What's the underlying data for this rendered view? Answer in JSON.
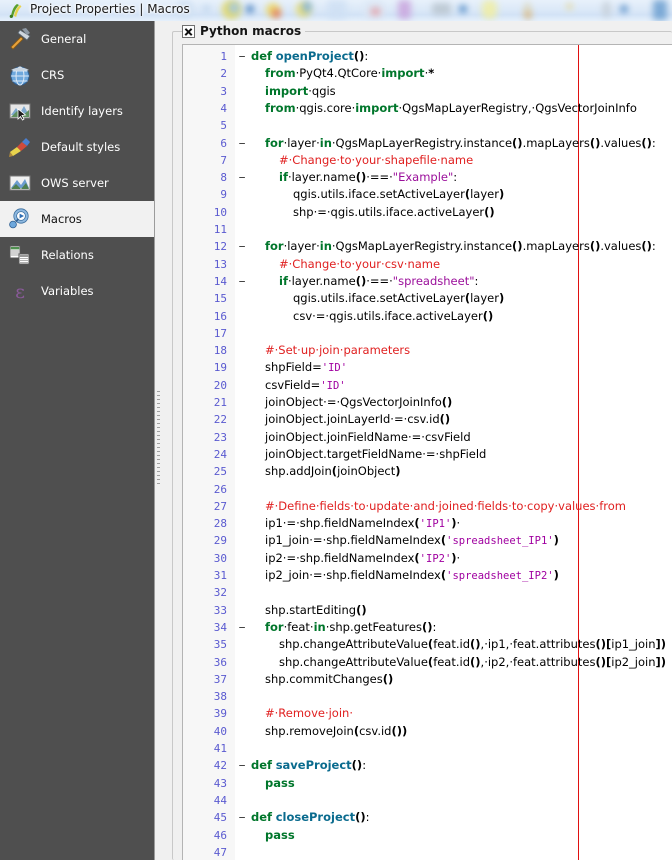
{
  "window": {
    "title": "Project Properties | Macros",
    "icon": "qgis-logo-icon"
  },
  "sidebar": {
    "items": [
      {
        "label": "General",
        "icon": "hammer-icon",
        "selected": false
      },
      {
        "label": "CRS",
        "icon": "globe-icon",
        "selected": false
      },
      {
        "label": "Identify layers",
        "icon": "identify-map-icon",
        "selected": false
      },
      {
        "label": "Default styles",
        "icon": "paintbrush-icon",
        "selected": false
      },
      {
        "label": "OWS server",
        "icon": "ows-map-icon",
        "selected": false
      },
      {
        "label": "Macros",
        "icon": "gear-play-icon",
        "selected": true
      },
      {
        "label": "Relations",
        "icon": "tables-icon",
        "selected": false
      },
      {
        "label": "Variables",
        "icon": "epsilon-icon",
        "selected": false
      }
    ]
  },
  "group": {
    "title": "Python macros",
    "checkbox_checked": true,
    "checkbox_glyph": "cross-check-icon"
  },
  "editor": {
    "first_line": 1,
    "last_line": 47,
    "margin_column_color": "#e01010",
    "lines": [
      {
        "n": 1,
        "fold": "−",
        "tokens": [
          {
            "t": "def",
            "c": "kw"
          },
          {
            "t": " ",
            "c": "sp"
          },
          {
            "t": "openProject",
            "c": "fn"
          },
          {
            "t": "()",
            "c": "pn"
          },
          {
            "t": ":",
            "c": "plain"
          }
        ]
      },
      {
        "n": 2,
        "fold": "",
        "indent": 1,
        "tokens": [
          {
            "t": "from",
            "c": "kw"
          },
          {
            "t": "·PyQt4.QtCore·",
            "c": "plain"
          },
          {
            "t": "import",
            "c": "kw"
          },
          {
            "t": "·",
            "c": "plain"
          },
          {
            "t": "*",
            "c": "pn"
          }
        ]
      },
      {
        "n": 3,
        "fold": "",
        "indent": 1,
        "tokens": [
          {
            "t": "import",
            "c": "kw"
          },
          {
            "t": "·qgis",
            "c": "plain"
          }
        ]
      },
      {
        "n": 4,
        "fold": "",
        "indent": 1,
        "tokens": [
          {
            "t": "from",
            "c": "kw"
          },
          {
            "t": "·qgis.core·",
            "c": "plain"
          },
          {
            "t": "import",
            "c": "kw"
          },
          {
            "t": "·QgsMapLayerRegistry,·QgsVectorJoinInfo",
            "c": "plain"
          }
        ]
      },
      {
        "n": 5,
        "fold": "",
        "indent": 1,
        "tokens": []
      },
      {
        "n": 6,
        "fold": "−",
        "indent": 1,
        "tokens": [
          {
            "t": "for",
            "c": "kw"
          },
          {
            "t": "·layer·",
            "c": "plain"
          },
          {
            "t": "in",
            "c": "kw"
          },
          {
            "t": "·QgsMapLayerRegistry.instance",
            "c": "plain"
          },
          {
            "t": "()",
            "c": "pn"
          },
          {
            "t": ".mapLayers",
            "c": "plain"
          },
          {
            "t": "()",
            "c": "pn"
          },
          {
            "t": ".values",
            "c": "plain"
          },
          {
            "t": "()",
            "c": "pn"
          },
          {
            "t": ":",
            "c": "plain"
          }
        ]
      },
      {
        "n": 7,
        "fold": "",
        "indent": 2,
        "tokens": [
          {
            "t": "#·Change·to·your·shapefile·name",
            "c": "cm"
          }
        ]
      },
      {
        "n": 8,
        "fold": "−",
        "indent": 2,
        "tokens": [
          {
            "t": "if",
            "c": "kw"
          },
          {
            "t": "·layer.name",
            "c": "plain"
          },
          {
            "t": "()",
            "c": "pn"
          },
          {
            "t": "·==·",
            "c": "plain"
          },
          {
            "t": "\"Example\"",
            "c": "dstr"
          },
          {
            "t": ":",
            "c": "plain"
          }
        ]
      },
      {
        "n": 9,
        "fold": "",
        "indent": 3,
        "tokens": [
          {
            "t": "qgis.utils.iface.setActiveLayer",
            "c": "plain"
          },
          {
            "t": "(",
            "c": "pn"
          },
          {
            "t": "layer",
            "c": "plain"
          },
          {
            "t": ")",
            "c": "pn"
          }
        ]
      },
      {
        "n": 10,
        "fold": "",
        "indent": 3,
        "tokens": [
          {
            "t": "shp·=·qgis.utils.iface.activeLayer",
            "c": "plain"
          },
          {
            "t": "()",
            "c": "pn"
          }
        ]
      },
      {
        "n": 11,
        "fold": "",
        "indent": 1,
        "tokens": []
      },
      {
        "n": 12,
        "fold": "−",
        "indent": 1,
        "tokens": [
          {
            "t": "for",
            "c": "kw"
          },
          {
            "t": "·layer·",
            "c": "plain"
          },
          {
            "t": "in",
            "c": "kw"
          },
          {
            "t": "·QgsMapLayerRegistry.instance",
            "c": "plain"
          },
          {
            "t": "()",
            "c": "pn"
          },
          {
            "t": ".mapLayers",
            "c": "plain"
          },
          {
            "t": "()",
            "c": "pn"
          },
          {
            "t": ".values",
            "c": "plain"
          },
          {
            "t": "()",
            "c": "pn"
          },
          {
            "t": ":",
            "c": "plain"
          }
        ]
      },
      {
        "n": 13,
        "fold": "",
        "indent": 2,
        "tokens": [
          {
            "t": "#·Change·to·your·csv·name",
            "c": "cm"
          }
        ]
      },
      {
        "n": 14,
        "fold": "−",
        "indent": 2,
        "tokens": [
          {
            "t": "if",
            "c": "kw"
          },
          {
            "t": "·layer.name",
            "c": "plain"
          },
          {
            "t": "()",
            "c": "pn"
          },
          {
            "t": "·==·",
            "c": "plain"
          },
          {
            "t": "\"spreadsheet\"",
            "c": "dstr"
          },
          {
            "t": ":",
            "c": "plain"
          }
        ]
      },
      {
        "n": 15,
        "fold": "",
        "indent": 3,
        "tokens": [
          {
            "t": "qgis.utils.iface.setActiveLayer",
            "c": "plain"
          },
          {
            "t": "(",
            "c": "pn"
          },
          {
            "t": "layer",
            "c": "plain"
          },
          {
            "t": ")",
            "c": "pn"
          }
        ]
      },
      {
        "n": 16,
        "fold": "",
        "indent": 3,
        "tokens": [
          {
            "t": "csv·=·qgis.utils.iface.activeLayer",
            "c": "plain"
          },
          {
            "t": "()",
            "c": "pn"
          }
        ]
      },
      {
        "n": 17,
        "fold": "",
        "indent": 1,
        "tokens": []
      },
      {
        "n": 18,
        "fold": "",
        "indent": 1,
        "tokens": [
          {
            "t": "#·Set·up·join·parameters",
            "c": "cm"
          }
        ]
      },
      {
        "n": 19,
        "fold": "",
        "indent": 1,
        "tokens": [
          {
            "t": "shpField=",
            "c": "plain"
          },
          {
            "t": "'ID'",
            "c": "str"
          }
        ]
      },
      {
        "n": 20,
        "fold": "",
        "indent": 1,
        "tokens": [
          {
            "t": "csvField=",
            "c": "plain"
          },
          {
            "t": "'ID'",
            "c": "str"
          }
        ]
      },
      {
        "n": 21,
        "fold": "",
        "indent": 1,
        "tokens": [
          {
            "t": "joinObject·=·QgsVectorJoinInfo",
            "c": "plain"
          },
          {
            "t": "()",
            "c": "pn"
          }
        ]
      },
      {
        "n": 22,
        "fold": "",
        "indent": 1,
        "tokens": [
          {
            "t": "joinObject.joinLayerId·=·csv.id",
            "c": "plain"
          },
          {
            "t": "()",
            "c": "pn"
          }
        ]
      },
      {
        "n": 23,
        "fold": "",
        "indent": 1,
        "tokens": [
          {
            "t": "joinObject.joinFieldName·=·csvField",
            "c": "plain"
          }
        ]
      },
      {
        "n": 24,
        "fold": "",
        "indent": 1,
        "tokens": [
          {
            "t": "joinObject.targetFieldName·=·shpField",
            "c": "plain"
          }
        ]
      },
      {
        "n": 25,
        "fold": "",
        "indent": 1,
        "tokens": [
          {
            "t": "shp.addJoin",
            "c": "plain"
          },
          {
            "t": "(",
            "c": "pn"
          },
          {
            "t": "joinObject",
            "c": "plain"
          },
          {
            "t": ")",
            "c": "pn"
          }
        ]
      },
      {
        "n": 26,
        "fold": "",
        "indent": 1,
        "tokens": []
      },
      {
        "n": 27,
        "fold": "",
        "indent": 1,
        "tokens": [
          {
            "t": "#·Define·fields·to·update·and·joined·fields·to·copy·values·from",
            "c": "cm"
          }
        ]
      },
      {
        "n": 28,
        "fold": "",
        "indent": 1,
        "tokens": [
          {
            "t": "ip1·=·shp.fieldNameIndex",
            "c": "plain"
          },
          {
            "t": "(",
            "c": "pn"
          },
          {
            "t": "'IP1'",
            "c": "str"
          },
          {
            "t": ")",
            "c": "pn"
          },
          {
            "t": "·",
            "c": "plain"
          }
        ]
      },
      {
        "n": 29,
        "fold": "",
        "indent": 1,
        "tokens": [
          {
            "t": "ip1_join·=·shp.fieldNameIndex",
            "c": "plain"
          },
          {
            "t": "(",
            "c": "pn"
          },
          {
            "t": "'spreadsheet_IP1'",
            "c": "str"
          },
          {
            "t": ")",
            "c": "pn"
          }
        ]
      },
      {
        "n": 30,
        "fold": "",
        "indent": 1,
        "tokens": [
          {
            "t": "ip2·=·shp.fieldNameIndex",
            "c": "plain"
          },
          {
            "t": "(",
            "c": "pn"
          },
          {
            "t": "'IP2'",
            "c": "str"
          },
          {
            "t": ")",
            "c": "pn"
          },
          {
            "t": "·",
            "c": "plain"
          }
        ]
      },
      {
        "n": 31,
        "fold": "",
        "indent": 1,
        "tokens": [
          {
            "t": "ip2_join·=·shp.fieldNameIndex",
            "c": "plain"
          },
          {
            "t": "(",
            "c": "pn"
          },
          {
            "t": "'spreadsheet_IP2'",
            "c": "str"
          },
          {
            "t": ")",
            "c": "pn"
          }
        ]
      },
      {
        "n": 32,
        "fold": "",
        "indent": 1,
        "tokens": []
      },
      {
        "n": 33,
        "fold": "",
        "indent": 1,
        "tokens": [
          {
            "t": "shp.startEditing",
            "c": "plain"
          },
          {
            "t": "()",
            "c": "pn"
          }
        ]
      },
      {
        "n": 34,
        "fold": "−",
        "indent": 1,
        "tokens": [
          {
            "t": "for",
            "c": "kw"
          },
          {
            "t": "·feat·",
            "c": "plain"
          },
          {
            "t": "in",
            "c": "kw"
          },
          {
            "t": "·shp.getFeatures",
            "c": "plain"
          },
          {
            "t": "()",
            "c": "pn"
          },
          {
            "t": ":",
            "c": "plain"
          }
        ]
      },
      {
        "n": 35,
        "fold": "",
        "indent": 2,
        "tokens": [
          {
            "t": "shp.changeAttributeValue",
            "c": "plain"
          },
          {
            "t": "(",
            "c": "pn"
          },
          {
            "t": "feat.id",
            "c": "plain"
          },
          {
            "t": "()",
            "c": "pn"
          },
          {
            "t": ",·ip1,·feat.attributes",
            "c": "plain"
          },
          {
            "t": "()[",
            "c": "pn"
          },
          {
            "t": "ip1_join",
            "c": "plain"
          },
          {
            "t": "])",
            "c": "pn"
          }
        ]
      },
      {
        "n": 36,
        "fold": "",
        "indent": 2,
        "tokens": [
          {
            "t": "shp.changeAttributeValue",
            "c": "plain"
          },
          {
            "t": "(",
            "c": "pn"
          },
          {
            "t": "feat.id",
            "c": "plain"
          },
          {
            "t": "()",
            "c": "pn"
          },
          {
            "t": ",·ip2,·feat.attributes",
            "c": "plain"
          },
          {
            "t": "()[",
            "c": "pn"
          },
          {
            "t": "ip2_join",
            "c": "plain"
          },
          {
            "t": "])",
            "c": "pn"
          }
        ]
      },
      {
        "n": 37,
        "fold": "",
        "indent": 1,
        "tokens": [
          {
            "t": "shp.commitChanges",
            "c": "plain"
          },
          {
            "t": "()",
            "c": "pn"
          }
        ]
      },
      {
        "n": 38,
        "fold": "",
        "indent": 1,
        "tokens": []
      },
      {
        "n": 39,
        "fold": "",
        "indent": 1,
        "tokens": [
          {
            "t": "#·Remove·join·",
            "c": "cm"
          }
        ]
      },
      {
        "n": 40,
        "fold": "",
        "indent": 1,
        "tokens": [
          {
            "t": "shp.removeJoin",
            "c": "plain"
          },
          {
            "t": "(",
            "c": "pn"
          },
          {
            "t": "csv.id",
            "c": "plain"
          },
          {
            "t": "())",
            "c": "pn"
          }
        ]
      },
      {
        "n": 41,
        "fold": "",
        "indent": 0,
        "tokens": []
      },
      {
        "n": 42,
        "fold": "−",
        "indent": 0,
        "tokens": [
          {
            "t": "def",
            "c": "kw"
          },
          {
            "t": " ",
            "c": "plain"
          },
          {
            "t": "saveProject",
            "c": "fn"
          },
          {
            "t": "()",
            "c": "pn"
          },
          {
            "t": ":",
            "c": "plain"
          }
        ]
      },
      {
        "n": 43,
        "fold": "",
        "indent": 1,
        "tokens": [
          {
            "t": "pass",
            "c": "kw"
          }
        ]
      },
      {
        "n": 44,
        "fold": "",
        "indent": 0,
        "tokens": []
      },
      {
        "n": 45,
        "fold": "−",
        "indent": 0,
        "tokens": [
          {
            "t": "def",
            "c": "kw"
          },
          {
            "t": " ",
            "c": "plain"
          },
          {
            "t": "closeProject",
            "c": "fn"
          },
          {
            "t": "()",
            "c": "pn"
          },
          {
            "t": ":",
            "c": "plain"
          }
        ]
      },
      {
        "n": 46,
        "fold": "",
        "indent": 1,
        "tokens": [
          {
            "t": "pass",
            "c": "kw"
          }
        ]
      },
      {
        "n": 47,
        "fold": "",
        "indent": 0,
        "tokens": []
      }
    ]
  },
  "colors": {
    "sidebar_bg": "#4f4f4f",
    "sidebar_selected_bg": "#f1f1f1",
    "dialog_bg": "#f0f0f0",
    "editor_bg": "#ffffff",
    "gutter_bg": "#f7f7f7",
    "linenumber_fg": "#5a5ad0",
    "keyword_fg": "#00762b",
    "function_fg": "#0a6b8e",
    "comment_fg": "#e02020",
    "string_fg": "#a000a0",
    "margin_marker": "#e01010"
  }
}
